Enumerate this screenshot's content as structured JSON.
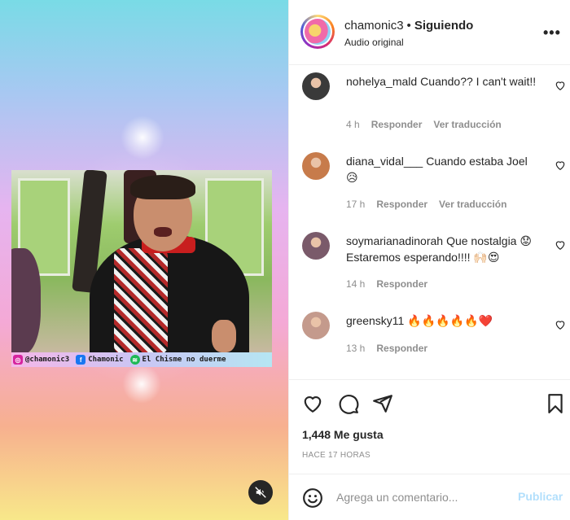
{
  "media": {
    "credits": [
      {
        "icon": "instagram-icon",
        "text": "@chamonic3"
      },
      {
        "icon": "facebook-icon",
        "text": "Chamonic"
      },
      {
        "icon": "spotify-icon",
        "text": "El Chisme no duerme"
      }
    ],
    "mute_icon": "muted-speaker-icon"
  },
  "header": {
    "username": "chamonic3",
    "separator": "•",
    "follow_status": "Siguiendo",
    "subtitle": "Audio original",
    "more": "•••"
  },
  "comments": [
    {
      "username": "nohelya_mald",
      "text": "Cuando?? I can't wait!!",
      "time": "4 h",
      "reply": "Responder",
      "translate": "Ver traducción",
      "avatar_color": "#3a3a3a"
    },
    {
      "username": "diana_vidal___",
      "text": "Cuando estaba Joel 😥",
      "time": "17 h",
      "reply": "Responder",
      "translate": "Ver traducción",
      "avatar_color": "#c77b4b"
    },
    {
      "username": "soymarianadinorah",
      "text": "Que nostalgia 😟 Estaremos esperando!!!! 🙌🏻😍",
      "time": "14 h",
      "reply": "Responder",
      "translate": "",
      "avatar_color": "#7a5a6a"
    },
    {
      "username": "greensky11",
      "text": "🔥🔥🔥🔥🔥❤️",
      "time": "13 h",
      "reply": "Responder",
      "translate": "",
      "avatar_color": "#c49a8c"
    }
  ],
  "actions": {
    "likes": "1,448 Me gusta",
    "time_ago": "Hace 17 horas"
  },
  "add_comment": {
    "placeholder": "Agrega un comentario...",
    "publish": "Publicar"
  }
}
